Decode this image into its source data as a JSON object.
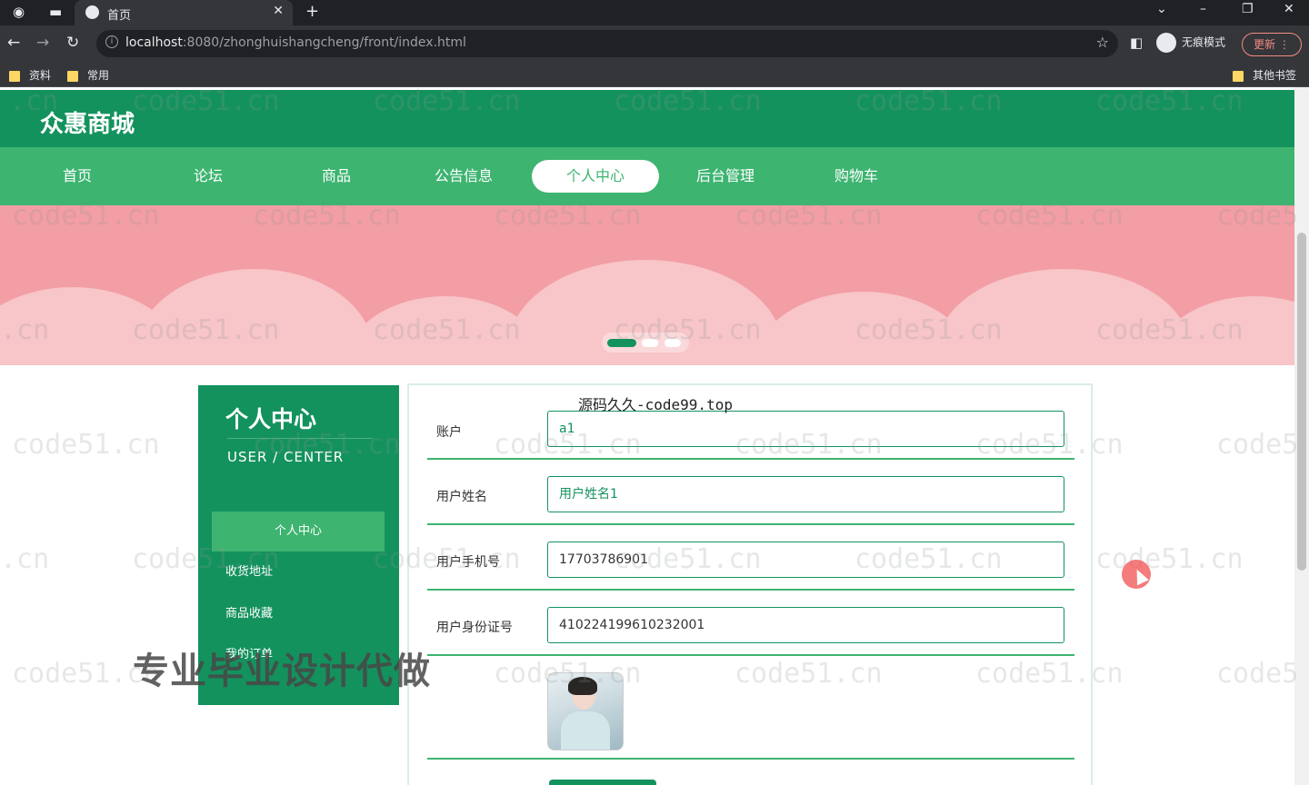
{
  "browser": {
    "tab_title": "首页",
    "new_tab": "+",
    "url_host": "localhost",
    "url_rest": ":8080/zhonghuishangcheng/front/index.html",
    "incognito_label": "无痕模式",
    "update_label": "更新",
    "bookmarks": [
      "资料",
      "常用"
    ],
    "other_bookmarks": "其他书签"
  },
  "site": {
    "logo": "众惠商城",
    "nav": [
      "首页",
      "论坛",
      "商品",
      "公告信息",
      "个人中心",
      "后台管理",
      "购物车"
    ],
    "active_nav": "个人中心"
  },
  "sidebar": {
    "title": "个人中心",
    "subtitle": "USER / CENTER",
    "items": [
      "个人中心",
      "收货地址",
      "商品收藏",
      "我的订单"
    ]
  },
  "form": {
    "fields": [
      {
        "label": "账户",
        "value": "a1"
      },
      {
        "label": "用户姓名",
        "value": "用户姓名1"
      },
      {
        "label": "用户手机号",
        "value": "17703786901"
      },
      {
        "label": "用户身份证号",
        "value": "410224199610232001"
      }
    ]
  },
  "overlay": {
    "source_label": "源码久久-code99.top",
    "promo": "专业毕业设计代做",
    "watermark": "code51.cn",
    "watermark_short": ".cn",
    "watermark_cut": "code5"
  },
  "colors": {
    "header": "#14925e",
    "nav": "#3db470",
    "banner": "#f29ea4"
  }
}
